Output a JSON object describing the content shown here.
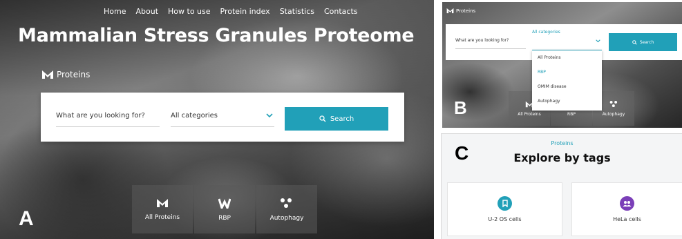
{
  "panel_a": {
    "label": "A",
    "nav": [
      "Home",
      "About",
      "How to use",
      "Protein index",
      "Statistics",
      "Contacts"
    ],
    "title": "Mammalian Stress Granules Proteome",
    "brand": "Proteins",
    "search": {
      "query_placeholder": "What are you looking for?",
      "category": "All categories",
      "button": "Search"
    },
    "tiles": [
      {
        "label": "All Proteins",
        "icon": "proteins-logo-icon"
      },
      {
        "label": "RBP",
        "icon": "rbp-logo-icon"
      },
      {
        "label": "Autophagy",
        "icon": "autophagy-dots-icon"
      }
    ]
  },
  "panel_b": {
    "label": "B",
    "brand": "Proteins",
    "search": {
      "query_placeholder": "What are you looking for?",
      "category_label": "All categories",
      "button": "Search"
    },
    "dropdown_options": [
      "All Proteins",
      "RBP",
      "OMIM disease",
      "Autophagy"
    ],
    "dropdown_selected": "RBP",
    "tiles": [
      {
        "label": "All Proteins",
        "icon": "proteins-logo-icon"
      },
      {
        "label": "RBP",
        "icon": "rbp-logo-icon"
      },
      {
        "label": "Autophagy",
        "icon": "autophagy-dots-icon"
      }
    ]
  },
  "panel_c": {
    "label": "C",
    "section": "Proteins",
    "title": "Explore by tags",
    "cards": [
      {
        "label": "U-2 OS cells",
        "icon": "bookmark-icon",
        "color": "#21a0b8"
      },
      {
        "label": "HeLa cells",
        "icon": "group-icon",
        "color": "#7b3fb8"
      }
    ]
  },
  "colors": {
    "accent": "#21a0b8",
    "purple": "#7b3fb8"
  }
}
